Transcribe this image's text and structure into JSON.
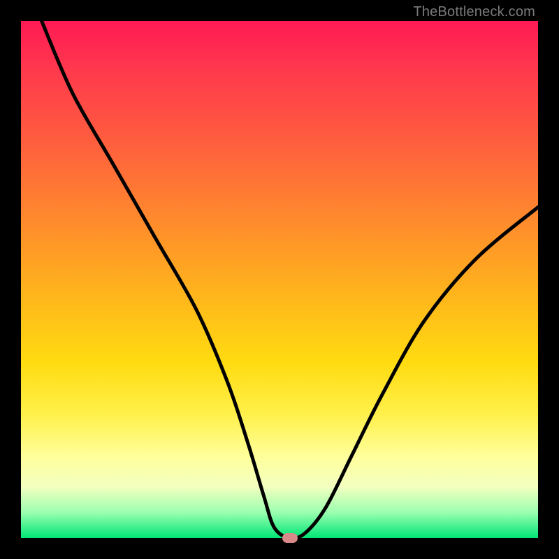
{
  "watermark": "TheBottleneck.com",
  "chart_data": {
    "type": "line",
    "title": "",
    "xlabel": "",
    "ylabel": "",
    "xlim": [
      0,
      100
    ],
    "ylim": [
      0,
      100
    ],
    "background_gradient": {
      "top_color": "#ff1a55",
      "mid_color": "#ffdb10",
      "bottom_color": "#00e676",
      "note": "vertical gradient red→orange→yellow→green representing bottleneck severity"
    },
    "marker": {
      "x": 52,
      "y": 0,
      "color": "#d88a8a"
    },
    "series": [
      {
        "name": "bottleneck-curve",
        "x": [
          4,
          10,
          18,
          26,
          34,
          40,
          44,
          47,
          49,
          52,
          55,
          59,
          64,
          70,
          78,
          88,
          100
        ],
        "y": [
          100,
          86,
          72,
          58,
          44,
          30,
          18,
          8,
          2,
          0,
          1,
          6,
          16,
          28,
          42,
          54,
          64
        ]
      }
    ]
  }
}
